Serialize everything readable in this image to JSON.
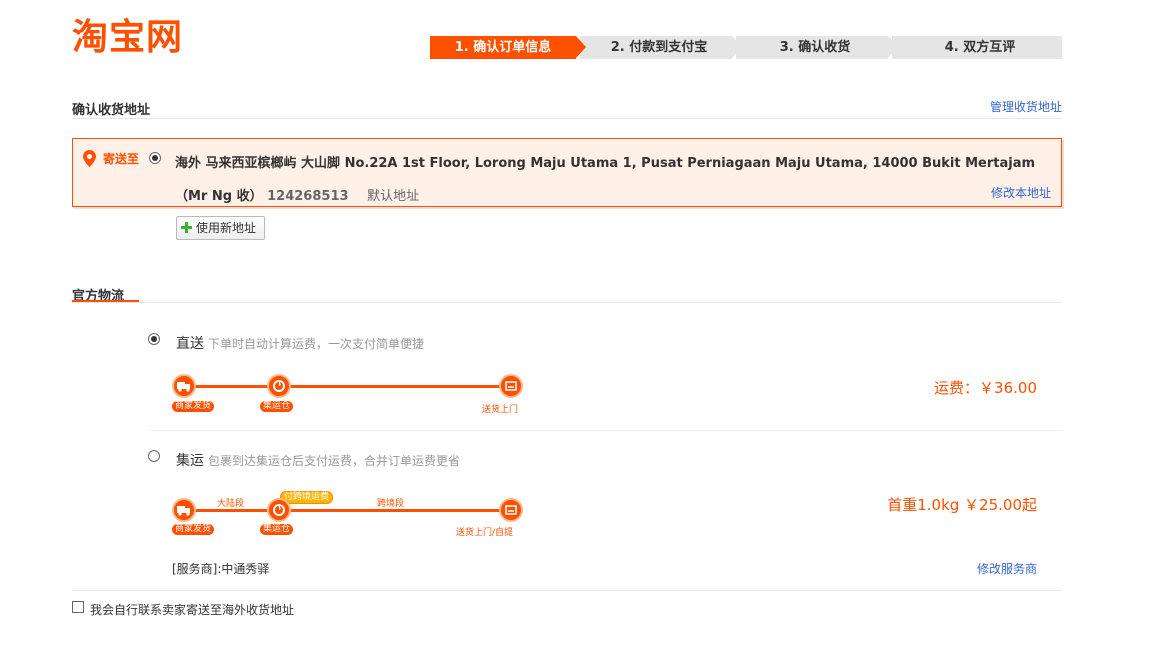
{
  "logo": {
    "text": "淘宝网"
  },
  "steps": [
    {
      "label": "1. 确认订单信息",
      "active": true
    },
    {
      "label": "2. 付款到支付宝",
      "active": false
    },
    {
      "label": "3. 确认收货",
      "active": false
    },
    {
      "label": "4. 双方互评",
      "active": false
    }
  ],
  "address_section": {
    "title": "确认收货地址",
    "manage_link": "管理收货地址",
    "send_to": "寄送至",
    "address_text": "海外 马来西亚槟榔屿 大山脚 No.22A 1st Floor, Lorong Maju Utama 1, Pusat Perniagaan Maju Utama, 14000 Bukit Mertajam（Mr Ng 收）",
    "phone": "124268513",
    "default_label": "默认地址",
    "edit_link": "修改本地址",
    "new_address_button": "使用新地址"
  },
  "logistics": {
    "title": "官方物流",
    "direct": {
      "label": "直送",
      "desc": "下单时自动计算运费，一次支付简单便捷",
      "fee": "运费：￥36.00",
      "route": {
        "start": "商家发货",
        "mid": "集运仓",
        "end": "送货上门"
      }
    },
    "consolidated": {
      "label": "集运",
      "desc": "包裹到达集运仓后支付运费，合并订单运费更省",
      "fee": "首重1.0kg ￥25.00起",
      "route": {
        "start": "商家发货",
        "mid": "集运仓",
        "end": "送货上门/自提",
        "seg1": "大陆段",
        "seg2": "跨境段",
        "pay_badge": "付跨境运费"
      },
      "provider": "[服务商]:中通秀驿",
      "change_provider": "修改服务商"
    }
  },
  "self_contact": "我会自行联系卖家寄送至海外收货地址",
  "colors": {
    "brand": "#ff5000",
    "link": "#3366cc"
  }
}
